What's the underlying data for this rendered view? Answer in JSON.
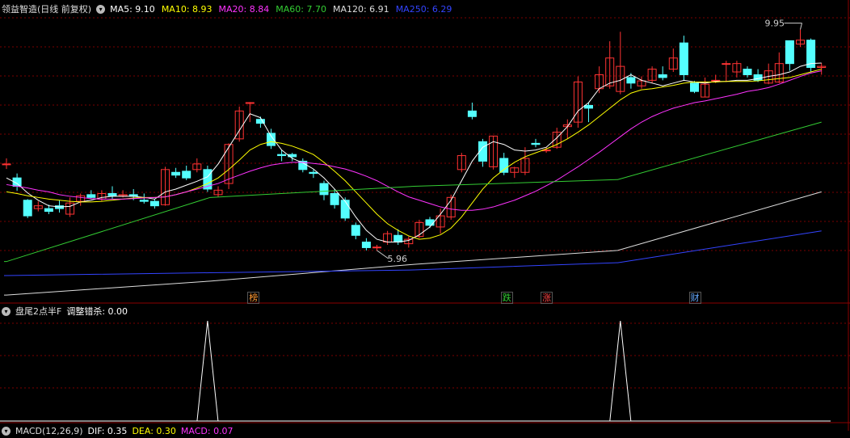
{
  "main_header": {
    "title": "领益智造(日线 前复权)",
    "ma": [
      {
        "label": "MA5: 9.10",
        "color": "#ffffff"
      },
      {
        "label": "MA10: 8.93",
        "color": "#ffff00"
      },
      {
        "label": "MA20: 8.84",
        "color": "#ff33ff"
      },
      {
        "label": "MA60: 7.70",
        "color": "#33cc33"
      },
      {
        "label": "MA120: 6.91",
        "color": "#dddddd"
      },
      {
        "label": "MA250: 6.29",
        "color": "#3344ff"
      }
    ]
  },
  "price_labels": {
    "high": "9.95",
    "low": "5.96"
  },
  "event_markers": [
    {
      "text": "榜",
      "color": "#ff9933"
    },
    {
      "text": "跌",
      "color": "#33cc33"
    },
    {
      "text": "涨",
      "color": "#ff4444"
    },
    {
      "text": "财",
      "color": "#66aaff"
    }
  ],
  "indicator_header": {
    "name": "盘尾2点半F",
    "line": "调整错杀: 0.00"
  },
  "macd_header": {
    "name": "MACD(12,26,9)",
    "dif": "DIF: 0.35",
    "dea": "DEA: 0.30",
    "macd": "MACD: 0.07"
  },
  "colors": {
    "up": "#ff3333",
    "down": "#54ffff",
    "grid": "#7a0000"
  },
  "chart_data": {
    "type": "candlestick",
    "candles": [
      [
        7.95,
        7.95,
        8.05,
        7.86
      ],
      [
        7.7,
        7.55,
        7.78,
        7.47
      ],
      [
        7.3,
        7.02,
        7.32,
        6.98
      ],
      [
        7.15,
        7.2,
        7.28,
        7.1
      ],
      [
        7.15,
        7.1,
        7.22,
        7.05
      ],
      [
        7.2,
        7.15,
        7.3,
        7.08
      ],
      [
        7.05,
        7.25,
        7.35,
        7.0
      ],
      [
        7.28,
        7.38,
        7.42,
        7.2
      ],
      [
        7.4,
        7.35,
        7.48,
        7.32
      ],
      [
        7.32,
        7.42,
        7.48,
        7.28
      ],
      [
        7.42,
        7.38,
        7.55,
        7.32
      ],
      [
        7.38,
        7.4,
        7.48,
        7.35
      ],
      [
        7.4,
        7.37,
        7.5,
        7.3
      ],
      [
        7.3,
        7.28,
        7.42,
        7.24
      ],
      [
        7.28,
        7.2,
        7.32,
        7.15
      ],
      [
        7.22,
        7.85,
        7.9,
        7.2
      ],
      [
        7.8,
        7.75,
        7.88,
        7.7
      ],
      [
        7.82,
        7.7,
        7.92,
        7.66
      ],
      [
        7.85,
        7.95,
        8.05,
        7.8
      ],
      [
        7.85,
        7.5,
        7.92,
        7.45
      ],
      [
        7.4,
        7.48,
        7.55,
        7.36
      ],
      [
        7.6,
        8.3,
        8.32,
        7.5
      ],
      [
        8.4,
        8.9,
        8.98,
        8.35
      ],
      [
        9.05,
        9.05,
        9.06,
        8.7
      ],
      [
        8.75,
        8.68,
        8.8,
        8.6
      ],
      [
        8.5,
        8.28,
        8.58,
        8.22
      ],
      [
        8.12,
        8.1,
        8.2,
        8.0
      ],
      [
        8.12,
        8.08,
        8.15,
        8.0
      ],
      [
        8.0,
        7.85,
        8.05,
        7.8
      ],
      [
        7.8,
        7.78,
        7.85,
        7.7
      ],
      [
        7.6,
        7.4,
        7.65,
        7.3
      ],
      [
        7.42,
        7.22,
        7.5,
        7.15
      ],
      [
        7.3,
        6.98,
        7.35,
        6.93
      ],
      [
        6.85,
        6.67,
        6.9,
        6.6
      ],
      [
        6.55,
        6.45,
        6.62,
        6.4
      ],
      [
        6.45,
        6.46,
        6.5,
        6.4
      ],
      [
        6.55,
        6.7,
        6.75,
        6.5
      ],
      [
        6.67,
        6.55,
        6.78,
        6.5
      ],
      [
        6.52,
        6.6,
        6.65,
        6.45
      ],
      [
        6.65,
        6.9,
        6.95,
        6.62
      ],
      [
        6.95,
        6.85,
        7.0,
        6.8
      ],
      [
        6.82,
        7.02,
        7.15,
        6.7
      ],
      [
        7.0,
        7.35,
        7.4,
        6.95
      ],
      [
        7.85,
        8.1,
        8.15,
        7.8
      ],
      [
        8.9,
        8.8,
        9.05,
        8.75
      ],
      [
        8.35,
        8.0,
        8.4,
        7.9
      ],
      [
        7.9,
        8.45,
        8.45,
        7.85
      ],
      [
        8.05,
        7.8,
        8.15,
        7.75
      ],
      [
        7.8,
        7.88,
        7.9,
        7.7
      ],
      [
        7.8,
        8.05,
        8.25,
        7.75
      ],
      [
        8.32,
        8.3,
        8.4,
        8.25
      ],
      [
        8.2,
        8.2,
        8.25,
        8.15
      ],
      [
        8.25,
        8.52,
        8.6,
        8.22
      ],
      [
        8.62,
        8.65,
        8.75,
        8.4
      ],
      [
        8.7,
        9.42,
        9.52,
        8.6
      ],
      [
        9.0,
        8.95,
        9.05,
        8.7
      ],
      [
        9.3,
        9.55,
        9.7,
        9.22
      ],
      [
        9.35,
        9.85,
        10.15,
        9.3
      ],
      [
        9.25,
        9.7,
        10.32,
        9.2
      ],
      [
        9.5,
        9.4,
        9.58,
        9.3
      ],
      [
        9.35,
        9.44,
        9.52,
        9.3
      ],
      [
        9.45,
        9.65,
        9.7,
        9.4
      ],
      [
        9.55,
        9.5,
        9.7,
        9.45
      ],
      [
        9.65,
        9.85,
        10.02,
        9.6
      ],
      [
        10.12,
        9.55,
        10.25,
        9.45
      ],
      [
        9.4,
        9.25,
        9.44,
        9.22
      ],
      [
        9.15,
        9.38,
        9.5,
        9.15
      ],
      [
        9.45,
        9.45,
        9.55,
        9.4
      ],
      [
        9.75,
        9.75,
        9.8,
        9.42
      ],
      [
        9.6,
        9.75,
        9.8,
        9.5
      ],
      [
        9.65,
        9.55,
        9.7,
        9.5
      ],
      [
        9.55,
        9.45,
        9.65,
        9.42
      ],
      [
        9.4,
        9.62,
        9.75,
        9.38
      ],
      [
        9.42,
        9.75,
        9.95,
        9.4
      ],
      [
        10.16,
        9.75,
        10.16,
        9.62
      ],
      [
        10.1,
        10.17,
        10.36,
        10.05
      ],
      [
        10.17,
        9.68,
        10.2,
        9.6
      ],
      [
        9.68,
        9.7,
        9.76,
        9.55
      ]
    ],
    "ma5": [
      7.7,
      7.6,
      7.43,
      7.3,
      7.2,
      7.18,
      7.19,
      7.27,
      7.3,
      7.35,
      7.37,
      7.37,
      7.37,
      7.35,
      7.32,
      7.45,
      7.5,
      7.57,
      7.64,
      7.72,
      7.95,
      8.25,
      8.55,
      8.85,
      8.78,
      8.45,
      8.2,
      8.05,
      7.97,
      7.86,
      7.7,
      7.5,
      7.28,
      7.0,
      6.76,
      6.6,
      6.55,
      6.55,
      6.58,
      6.68,
      6.82,
      7.05,
      7.3,
      7.65,
      8.0,
      8.25,
      8.35,
      8.3,
      8.2,
      8.18,
      8.2,
      8.25,
      8.42,
      8.62,
      8.9,
      9.05,
      9.3,
      9.4,
      9.45,
      9.55,
      9.45,
      9.4,
      9.35,
      9.4,
      9.45,
      9.42,
      9.4,
      9.43,
      9.43,
      9.45,
      9.45,
      9.48,
      9.52,
      9.55,
      9.6,
      9.7,
      9.75,
      9.76
    ],
    "ma10": [
      7.45,
      7.42,
      7.38,
      7.35,
      7.32,
      7.3,
      7.28,
      7.27,
      7.27,
      7.28,
      7.3,
      7.32,
      7.34,
      7.35,
      7.35,
      7.36,
      7.4,
      7.45,
      7.52,
      7.6,
      7.7,
      7.85,
      8.02,
      8.2,
      8.3,
      8.35,
      8.32,
      8.27,
      8.2,
      8.12,
      7.98,
      7.82,
      7.65,
      7.45,
      7.25,
      7.05,
      6.88,
      6.76,
      6.66,
      6.6,
      6.62,
      6.68,
      6.8,
      7.0,
      7.25,
      7.5,
      7.7,
      7.85,
      7.98,
      8.08,
      8.15,
      8.22,
      8.3,
      8.4,
      8.52,
      8.65,
      8.8,
      8.95,
      9.1,
      9.22,
      9.28,
      9.3,
      9.33,
      9.36,
      9.4,
      9.42,
      9.42,
      9.42,
      9.43,
      9.43,
      9.43,
      9.44,
      9.46,
      9.48,
      9.5,
      9.55,
      9.6,
      9.65
    ],
    "ma20": [
      7.58,
      7.55,
      7.52,
      7.48,
      7.45,
      7.4,
      7.37,
      7.35,
      7.33,
      7.32,
      7.32,
      7.32,
      7.33,
      7.34,
      7.35,
      7.36,
      7.4,
      7.45,
      7.5,
      7.55,
      7.6,
      7.68,
      7.75,
      7.82,
      7.88,
      7.93,
      7.96,
      7.98,
      7.98,
      7.96,
      7.94,
      7.9,
      7.86,
      7.8,
      7.73,
      7.65,
      7.55,
      7.45,
      7.36,
      7.3,
      7.24,
      7.18,
      7.14,
      7.12,
      7.12,
      7.14,
      7.18,
      7.24,
      7.3,
      7.38,
      7.46,
      7.56,
      7.66,
      7.78,
      7.9,
      8.03,
      8.16,
      8.3,
      8.44,
      8.58,
      8.7,
      8.8,
      8.88,
      8.95,
      9.0,
      9.05,
      9.08,
      9.12,
      9.16,
      9.2,
      9.25,
      9.28,
      9.32,
      9.38,
      9.45,
      9.52,
      9.58,
      9.62
    ],
    "ma60_from": [
      6.2,
      7.35,
      7.55,
      7.67,
      8.7
    ],
    "ma120_from": [
      5.6,
      5.85,
      6.15,
      6.4,
      7.45
    ],
    "ma250_from": [
      5.95,
      6.0,
      6.05,
      6.18,
      6.75
    ],
    "ylim": [
      5.5,
      10.6
    ],
    "indicator": {
      "spikes": [
        19,
        58
      ],
      "range": [
        0,
        1
      ]
    }
  }
}
